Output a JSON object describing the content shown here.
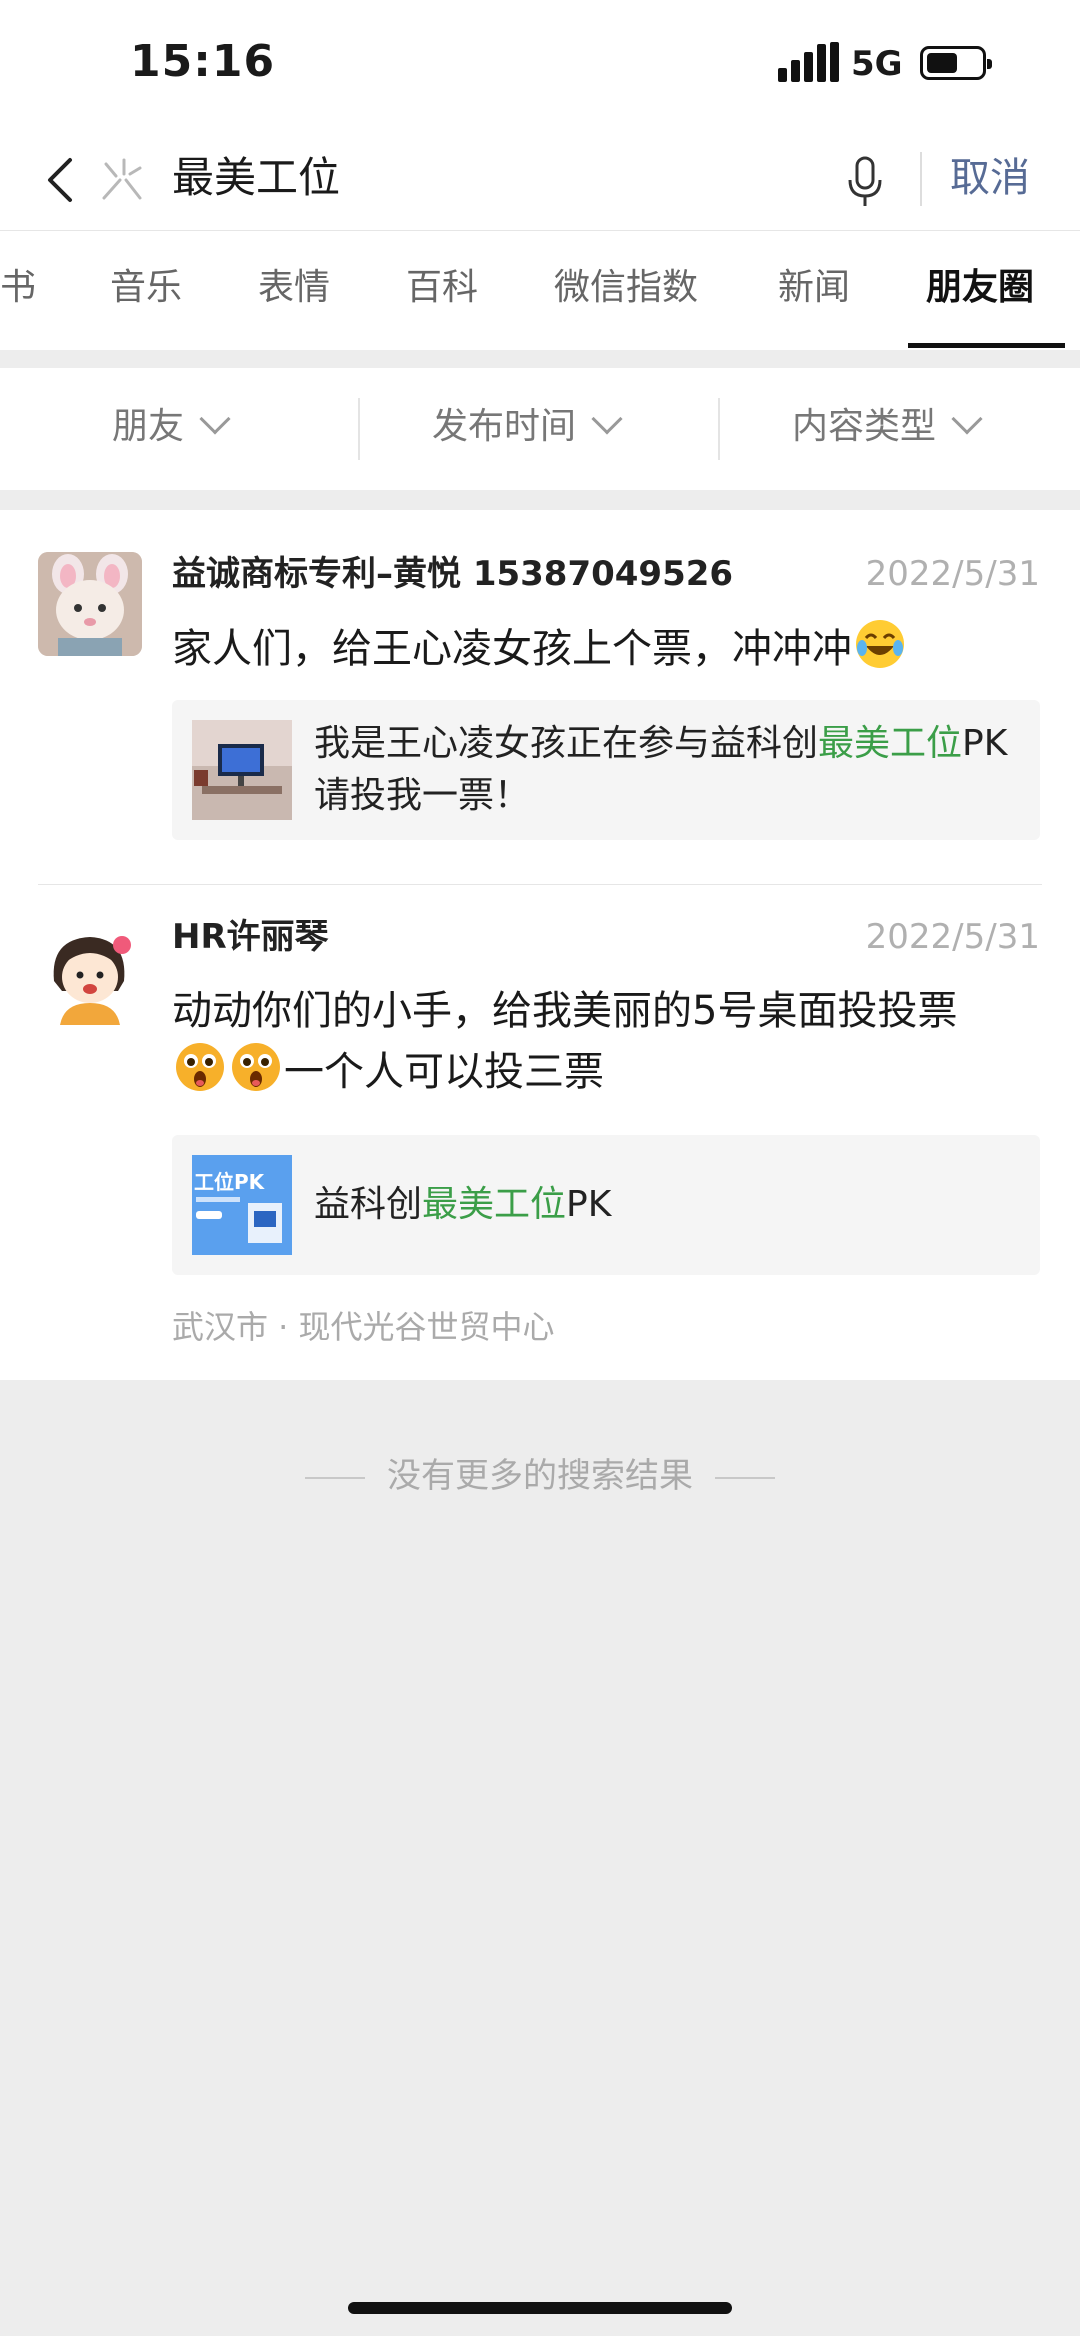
{
  "status_bar": {
    "time": "15:16",
    "network": "5G"
  },
  "search": {
    "query": "最美工位",
    "cancel_label": "取消"
  },
  "tabs": [
    {
      "label": "书"
    },
    {
      "label": "音乐"
    },
    {
      "label": "表情"
    },
    {
      "label": "百科"
    },
    {
      "label": "微信指数"
    },
    {
      "label": "新闻"
    },
    {
      "label": "朋友圈",
      "active": true
    }
  ],
  "filters": [
    {
      "label": "朋友"
    },
    {
      "label": "发布时间"
    },
    {
      "label": "内容类型"
    }
  ],
  "posts": [
    {
      "author": "益诚商标专利–黄悦 15387049526",
      "date": "2022/5/31",
      "text": "家人们，给王心凌女孩上个票，冲冲冲",
      "text_emoji": "laughing-tears",
      "card": {
        "text_before": "我是王心凌女孩正在参与益科创",
        "highlight": "最美工位",
        "text_after": "PK请投我一票！"
      }
    },
    {
      "author": "HR许丽琴",
      "date": "2022/5/31",
      "text_line1": "动动你们的小手，给我美丽的5号桌面投投票",
      "text_line2": "一个人可以投三票",
      "line2_emoji": "surprised-face",
      "card": {
        "text_before": "益科创",
        "highlight": "最美工位",
        "text_after": "PK",
        "thumb_caption": "工位PK"
      },
      "location": "武汉市 · 现代光谷世贸中心"
    }
  ],
  "footer": {
    "no_more": "没有更多的搜索结果"
  },
  "colors": {
    "highlight": "#3b9e48",
    "cancel": "#576b95",
    "background": "#ededed"
  }
}
